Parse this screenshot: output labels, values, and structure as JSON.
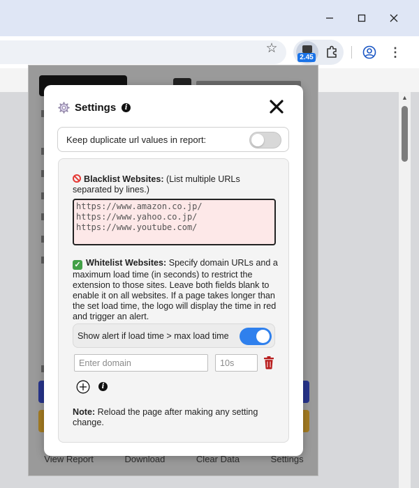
{
  "browser": {
    "extension_badge": "2.45"
  },
  "popup_behind": {
    "footer_links": [
      "View Report",
      "Download",
      "Clear Data",
      "Settings"
    ]
  },
  "settings": {
    "title": "Settings",
    "duplicate_toggle_label": "Keep duplicate url values in report:",
    "duplicate_toggle_on": false,
    "blacklist": {
      "heading": "Blacklist Websites:",
      "hint": " (List multiple URLs separated by lines.)",
      "urls": "https://www.amazon.co.jp/\nhttps://www.yahoo.co.jp/\nhttps://www.youtube.com/"
    },
    "whitelist": {
      "heading": "Whitelist Websites:",
      "description": " Specify domain URLs and a maximum load time (in seconds) to restrict the extension to those sites. Leave both fields blank to enable it on all websites. If a page takes longer than the set load time, the logo will display the time in red and trigger an alert."
    },
    "alert_toggle_label": "Show alert if load time > max load time",
    "alert_toggle_on": true,
    "domain_placeholder": "Enter domain",
    "time_placeholder": "10s",
    "note_label": "Note:",
    "note_text": " Reload the page after making any setting change."
  },
  "colors": {
    "toggle_on": "#2f80ed",
    "blacklist_bg": "#fde8e8",
    "trash": "#b71c1c"
  }
}
